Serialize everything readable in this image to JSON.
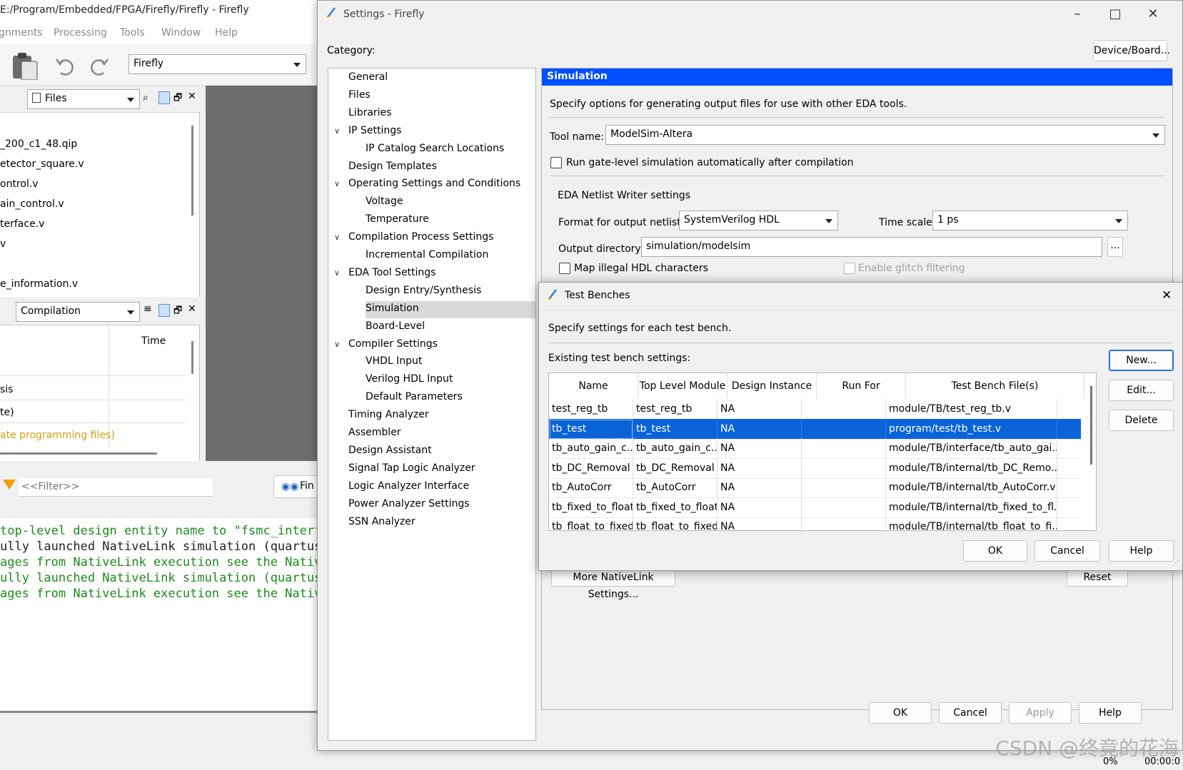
{
  "main": {
    "title": "E:/Program/Embedded/FPGA/Firefly/Firefly - Firefly",
    "menu": [
      "gnments",
      "Processing",
      "Tools",
      "Window",
      "Help"
    ],
    "project_combo": "Firefly",
    "files_combo": "Files",
    "files": [
      "_200_c1_48.qip",
      "etector_square.v",
      "ontrol.v",
      "ain_control.v",
      "terface.v",
      "v",
      "e_information.v"
    ],
    "compilation_combo": "Compilation",
    "time_header": "Time",
    "tasks": [
      "sis",
      "te)",
      "ate programming files)"
    ],
    "filter_placeholder": "<<Filter>>",
    "find_label": "Fin",
    "console": [
      "top-level design entity name to \"fsmc_interfa",
      "ully launched NativeLink simulation (quartus_",
      "ages from NativeLink execution see the Native",
      "ully launched NativeLink simulation (quartus_",
      "ages from NativeLink execution see the Native"
    ],
    "status_percent": "0%",
    "status_time": "00:00:0"
  },
  "settings": {
    "title": "Settings - Firefly",
    "category_label": "Category:",
    "device_board_button": "Device/Board...",
    "categories": [
      {
        "label": "General",
        "level": 0
      },
      {
        "label": "Files",
        "level": 0
      },
      {
        "label": "Libraries",
        "level": 0
      },
      {
        "label": "IP Settings",
        "level": 0,
        "expanded": true
      },
      {
        "label": "IP Catalog Search Locations",
        "level": 1
      },
      {
        "label": "Design Templates",
        "level": 0
      },
      {
        "label": "Operating Settings and Conditions",
        "level": 0,
        "expanded": true
      },
      {
        "label": "Voltage",
        "level": 1
      },
      {
        "label": "Temperature",
        "level": 1
      },
      {
        "label": "Compilation Process Settings",
        "level": 0,
        "expanded": true
      },
      {
        "label": "Incremental Compilation",
        "level": 1
      },
      {
        "label": "EDA Tool Settings",
        "level": 0,
        "expanded": true
      },
      {
        "label": "Design Entry/Synthesis",
        "level": 1
      },
      {
        "label": "Simulation",
        "level": 1,
        "selected": true
      },
      {
        "label": "Board-Level",
        "level": 1
      },
      {
        "label": "Compiler Settings",
        "level": 0,
        "expanded": true
      },
      {
        "label": "VHDL Input",
        "level": 1
      },
      {
        "label": "Verilog HDL Input",
        "level": 1
      },
      {
        "label": "Default Parameters",
        "level": 1
      },
      {
        "label": "Timing Analyzer",
        "level": 0
      },
      {
        "label": "Assembler",
        "level": 0
      },
      {
        "label": "Design Assistant",
        "level": 0
      },
      {
        "label": "Signal Tap Logic Analyzer",
        "level": 0
      },
      {
        "label": "Logic Analyzer Interface",
        "level": 0
      },
      {
        "label": "Power Analyzer Settings",
        "level": 0
      },
      {
        "label": "SSN Analyzer",
        "level": 0
      }
    ],
    "panel_title": "Simulation",
    "description": "Specify options for generating output files for use with other EDA tools.",
    "tool_name_label": "Tool name:",
    "tool_name_value": "ModelSim-Altera",
    "run_gate_level_label": "Run gate-level simulation automatically after compilation",
    "netlist_group_label": "EDA Netlist Writer settings",
    "format_label": "Format for output netlist:",
    "format_value": "SystemVerilog HDL",
    "timescale_label": "Time scale:",
    "timescale_value": "1 ps",
    "output_dir_label": "Output directory:",
    "output_dir_value": "simulation/modelsim",
    "browse_label": "...",
    "map_illegal_label": "Map illegal HDL characters",
    "glitch_label": "Enable glitch filtering",
    "more_nativelink_button": "More NativeLink Settings...",
    "reset_button": "Reset",
    "ok_button": "OK",
    "cancel_button": "Cancel",
    "apply_button": "Apply",
    "help_button": "Help"
  },
  "test_benches": {
    "title": "Test Benches",
    "description": "Specify settings for each test bench.",
    "existing_label": "Existing test bench settings:",
    "columns": [
      "Name",
      "Top Level Module",
      "Design Instance",
      "Run For",
      "Test Bench File(s)"
    ],
    "rows": [
      [
        "test_reg_tb",
        "test_reg_tb",
        "NA",
        "",
        "module/TB/test_reg_tb.v"
      ],
      [
        "tb_test",
        "tb_test",
        "NA",
        "",
        "program/test/tb_test.v"
      ],
      [
        "tb_auto_gain_c...",
        "tb_auto_gain_c...",
        "NA",
        "",
        "module/TB/interface/tb_auto_gai..."
      ],
      [
        "tb_DC_Removal",
        "tb_DC_Removal",
        "NA",
        "",
        "module/TB/internal/tb_DC_Remo..."
      ],
      [
        "tb_AutoCorr",
        "tb_AutoCorr",
        "NA",
        "",
        "module/TB/internal/tb_AutoCorr.v"
      ],
      [
        "tb_fixed_to_float",
        "tb_fixed_to_float",
        "NA",
        "",
        "module/TB/internal/tb_fixed_to_fl..."
      ],
      [
        "tb_float_to_fixed",
        "tb_float_to_fixed",
        "NA",
        "",
        "module/TB/internal/tb_float_to_fi..."
      ]
    ],
    "selected_row": 1,
    "new_button": "New...",
    "edit_button": "Edit...",
    "delete_button": "Delete",
    "ok_button": "OK",
    "cancel_button": "Cancel",
    "help_button": "Help"
  },
  "watermark": "CSDN @终竟的花海",
  "colors": {
    "selection_blue": "#0a64d8",
    "header_blue": "#0050ff",
    "console_green": "#1e8a1e",
    "task_orange": "#d4a017"
  }
}
